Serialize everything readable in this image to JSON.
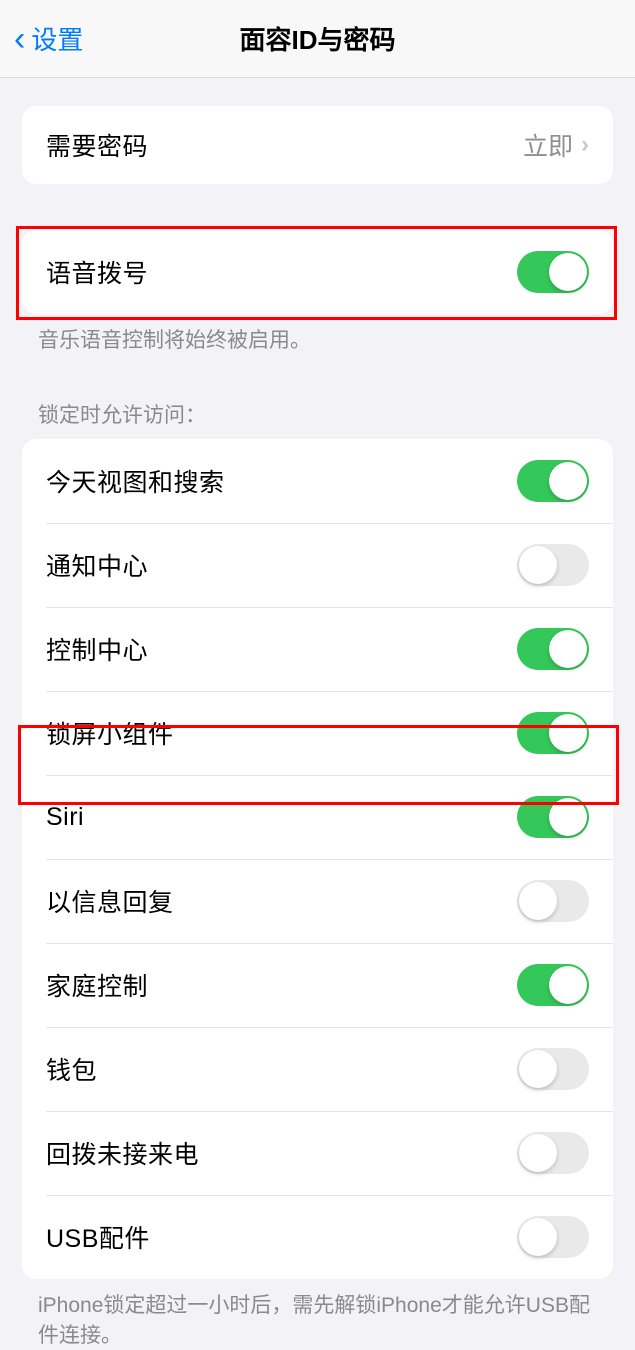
{
  "nav": {
    "back_label": "设置",
    "title": "面容ID与密码"
  },
  "require_passcode": {
    "label": "需要密码",
    "value": "立即"
  },
  "voice_dial": {
    "label": "语音拨号",
    "footer": "音乐语音控制将始终被启用。",
    "on": true
  },
  "allow_access_header": "锁定时允许访问：",
  "allow_access": [
    {
      "label": "今天视图和搜索",
      "on": true
    },
    {
      "label": "通知中心",
      "on": false
    },
    {
      "label": "控制中心",
      "on": true
    },
    {
      "label": "锁屏小组件",
      "on": true
    },
    {
      "label": "Siri",
      "on": true
    },
    {
      "label": "以信息回复",
      "on": false
    },
    {
      "label": "家庭控制",
      "on": true
    },
    {
      "label": "钱包",
      "on": false
    },
    {
      "label": "回拨未接来电",
      "on": false
    },
    {
      "label": "USB配件",
      "on": false
    }
  ],
  "usb_footer": "iPhone锁定超过一小时后，需先解锁iPhone才能允许USB配件连接。"
}
